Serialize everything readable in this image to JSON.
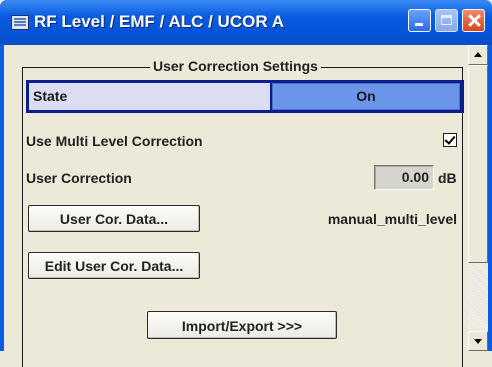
{
  "window": {
    "title": "RF Level / EMF / ALC / UCOR A",
    "icons": [
      "app-icon",
      "minimize-icon",
      "maximize-icon",
      "close-icon"
    ]
  },
  "group": {
    "title": "User Correction Settings"
  },
  "state": {
    "label": "State",
    "value": "On"
  },
  "multi_level": {
    "label": "Use Multi Level Correction",
    "checked": true
  },
  "user_correction": {
    "label": "User Correction",
    "value": "0.00",
    "unit": "dB"
  },
  "buttons": {
    "user_cor_data": "User Cor. Data...",
    "edit_user_cor_data": "Edit User Cor. Data...",
    "import_export": "Import/Export >>>"
  },
  "user_cor_data_file": "manual_multi_level",
  "colors": {
    "title_bar": "#0a5ce0",
    "state_highlight": "#0b1e8c",
    "state_value_bg": "#6b95e8",
    "dialog_bg": "#ece9d8"
  }
}
